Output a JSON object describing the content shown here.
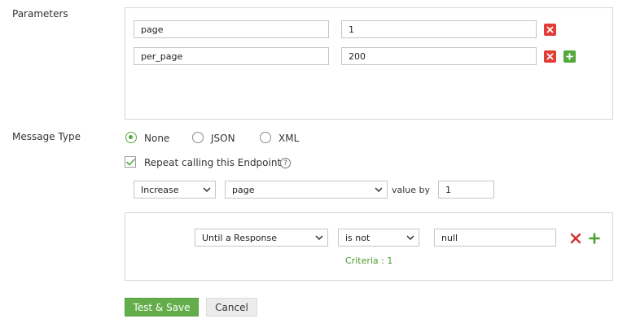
{
  "parameters": {
    "label": "Parameters",
    "rows": [
      {
        "key": "page",
        "value": "1"
      },
      {
        "key": "per_page",
        "value": "200"
      }
    ]
  },
  "message_type": {
    "label": "Message Type",
    "options": [
      "None",
      "JSON",
      "XML"
    ],
    "selected": "None"
  },
  "repeat": {
    "label": "Repeat calling this Endpoint",
    "checked": true,
    "help_glyph": "?",
    "operation": "Increase",
    "parameter": "page",
    "value_by_label": "value by",
    "value_by": "1"
  },
  "criteria": {
    "condition": "Until a Response",
    "operator": "is not",
    "value": "null",
    "count_text": "Criteria : 1"
  },
  "actions": {
    "test_save": "Test & Save",
    "cancel": "Cancel"
  },
  "colors": {
    "accent_green": "#55a93f",
    "remove_red": "#e33b35",
    "primary_button": "#63ae4a"
  },
  "icons": {
    "remove": "close-icon",
    "add": "plus-icon",
    "dropdown": "chevron-down-icon",
    "help": "help-icon",
    "check": "check-icon"
  }
}
